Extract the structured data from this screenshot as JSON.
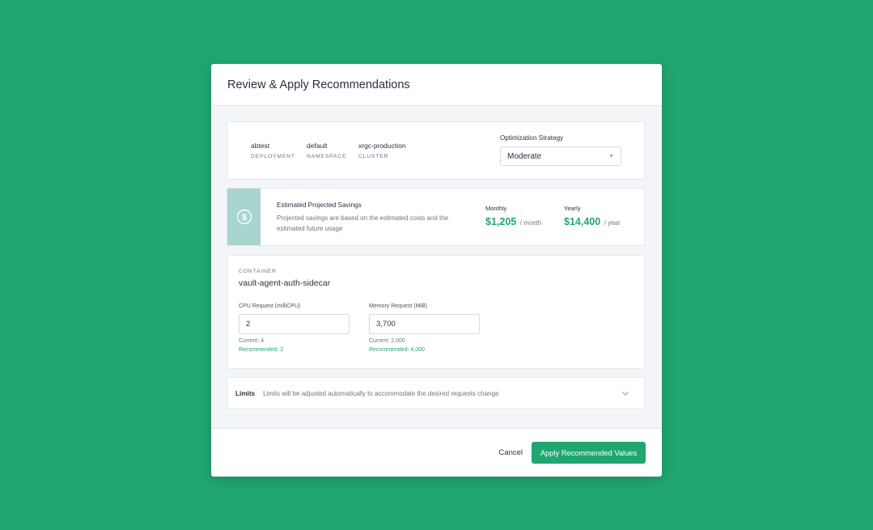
{
  "modal": {
    "title": "Review & Apply Recommendations"
  },
  "info": {
    "items": [
      {
        "value": "abtest",
        "key": "DEPLOYMENT"
      },
      {
        "value": "default",
        "key": "NAMESPACE"
      },
      {
        "value": "xrgc-production",
        "key": "CLUSTER"
      }
    ],
    "strategy_label": "Optimization Strategy",
    "strategy_value": "Moderate"
  },
  "savings": {
    "icon": "dollar-circle-icon",
    "title": "Estimated Projected Savings",
    "description": "Projected savings are based on the estimated costs and the estimated future usage",
    "monthly_label": "Monthly",
    "monthly_value": "$1,205",
    "monthly_unit": "/ month",
    "yearly_label": "Yearly",
    "yearly_value": "$14,400",
    "yearly_unit": "/ year"
  },
  "container": {
    "label": "CONTAINER",
    "name": "vault-agent-auth-sidecar",
    "cpu": {
      "label": "CPU Request (milliCPU)",
      "value": "2",
      "current": "Current: 4",
      "recommended": "Recommended: 2"
    },
    "memory": {
      "label": "Memory Request (MiB)",
      "value": "3,700",
      "current": "Current: 2,000",
      "recommended": "Recommended: 4,000"
    }
  },
  "limits": {
    "title": "Limits",
    "description": "Limits will be adjusted automatically to accommodate the desired requests change"
  },
  "footer": {
    "cancel_label": "Cancel",
    "apply_label": "Apply Recommended Values"
  },
  "colors": {
    "background": "#21a671",
    "accent": "#21a671",
    "savings_panel": "#a8d5d0"
  }
}
